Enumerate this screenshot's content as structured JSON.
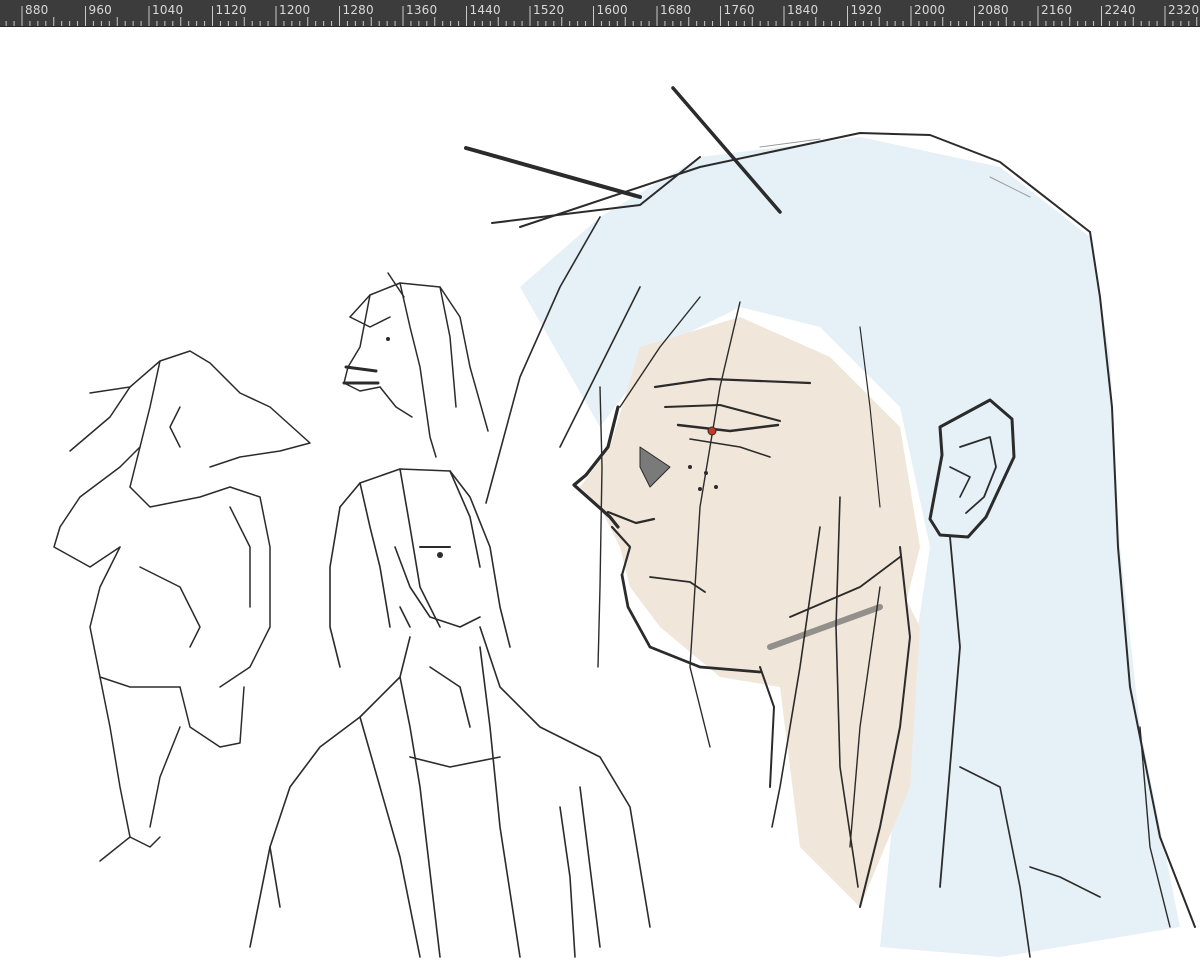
{
  "ruler": {
    "labels": [
      "880",
      "960",
      "1040",
      "1120",
      "1200",
      "1280",
      "1360",
      "1440",
      "1520",
      "1600",
      "1680",
      "1760",
      "1840",
      "1920",
      "2000",
      "2080",
      "2160",
      "2240",
      "2320"
    ]
  },
  "colors": {
    "ruler_background": "#3c3c3c",
    "ruler_text": "#d9d9d9",
    "canvas_background": "#ffffff",
    "sketch_line": "#2b2b2b",
    "hair_tint": "#dcebf5",
    "skin_tint": "#efe3d6",
    "eye_accent": "#c23a2a"
  }
}
